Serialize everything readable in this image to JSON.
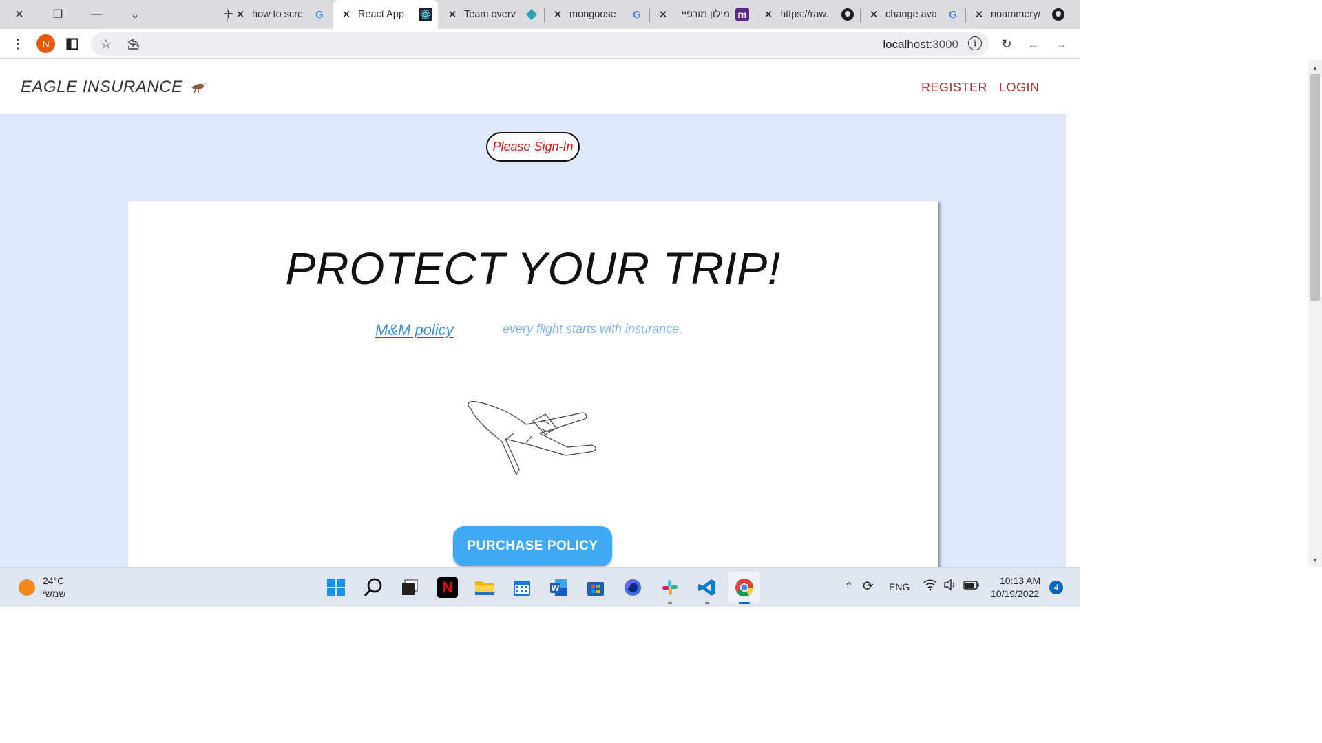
{
  "browser": {
    "tabs": [
      {
        "label": "how to scre",
        "icon": "google-icon"
      },
      {
        "label": "React App",
        "icon": "react-icon",
        "active": true
      },
      {
        "label": "Team overv",
        "icon": "diamond-icon"
      },
      {
        "label": "mongoose",
        "icon": "google-icon"
      },
      {
        "label": "מילון מורפיי",
        "icon": "morfix-icon"
      },
      {
        "label": "https://raw.",
        "icon": "github-icon"
      },
      {
        "label": "change ava",
        "icon": "google-icon"
      },
      {
        "label": "noammery/",
        "icon": "github-icon"
      }
    ],
    "profile_initial": "N",
    "url_host": "localhost",
    "url_port": ":3000"
  },
  "page": {
    "brand": "EAGLE INSURANCE",
    "nav": {
      "register": "REGISTER",
      "login": "LOGIN"
    },
    "signin_badge": "Please Sign-In",
    "hero_title": "PROTECT YOUR TRIP!",
    "policy_link": "M&M policy",
    "tagline": "every flight starts with insurance.",
    "purchase_button": "PURCHASE POLICY"
  },
  "taskbar": {
    "weather_temp": "24°C",
    "weather_desc": "שמשי",
    "language": "ENG",
    "time": "10:13 AM",
    "date": "10/19/2022",
    "notification_count": "4"
  },
  "colors": {
    "page_background": "#dfe7fb",
    "nav_link": "#b5302d",
    "signin_text": "#e01818",
    "link_blue": "#3d8fe0",
    "button_blue": "#3fa9f5"
  }
}
